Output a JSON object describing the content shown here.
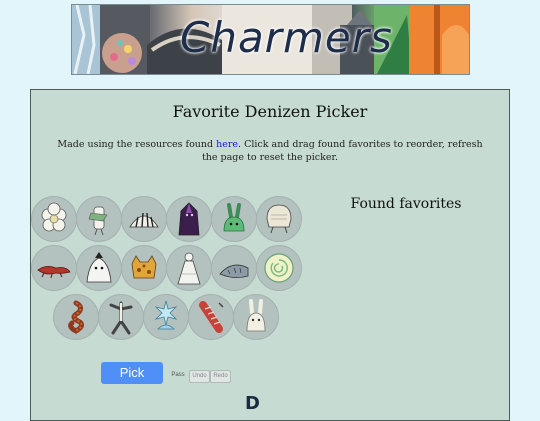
{
  "banner": {
    "title": "Charmers",
    "icon": "charmers-banner-art"
  },
  "picker": {
    "title": "Favorite Denizen Picker",
    "desc_before": "Made using the resources found ",
    "desc_link": "here",
    "desc_after": ". Click and drag found favorites to reorder, refresh the page to reset the picker."
  },
  "found": {
    "title": "Found favorites"
  },
  "denizens": [
    {
      "icon": "white-flower-denizen-icon"
    },
    {
      "icon": "scarf-figure-denizen-icon"
    },
    {
      "icon": "striped-shell-denizen-icon"
    },
    {
      "icon": "purple-cloak-denizen-icon"
    },
    {
      "icon": "green-rabbit-denizen-icon"
    },
    {
      "icon": "hooded-bag-denizen-icon"
    },
    {
      "icon": "red-lizard-denizen-icon"
    },
    {
      "icon": "white-ghost-denizen-icon"
    },
    {
      "icon": "spotted-cat-denizen-icon"
    },
    {
      "icon": "white-dress-denizen-icon"
    },
    {
      "icon": "grey-fish-denizen-icon"
    },
    {
      "icon": "spiral-shell-denizen-icon"
    },
    {
      "icon": "coiled-worm-denizen-icon"
    },
    {
      "icon": "dancing-stick-denizen-icon"
    },
    {
      "icon": "blue-sprite-denizen-icon"
    },
    {
      "icon": "red-striped-denizen-icon"
    },
    {
      "icon": "white-rabbit-denizen-icon"
    }
  ],
  "controls": {
    "pick": "Pick",
    "pass": "Pass",
    "undo": "Undo",
    "redo": "Redo"
  },
  "colors": {
    "page_bg": "#e2f5fb",
    "card_bg": "#c6dbd2",
    "pick_button": "#4f8ff7",
    "link": "#1a1ad8"
  }
}
